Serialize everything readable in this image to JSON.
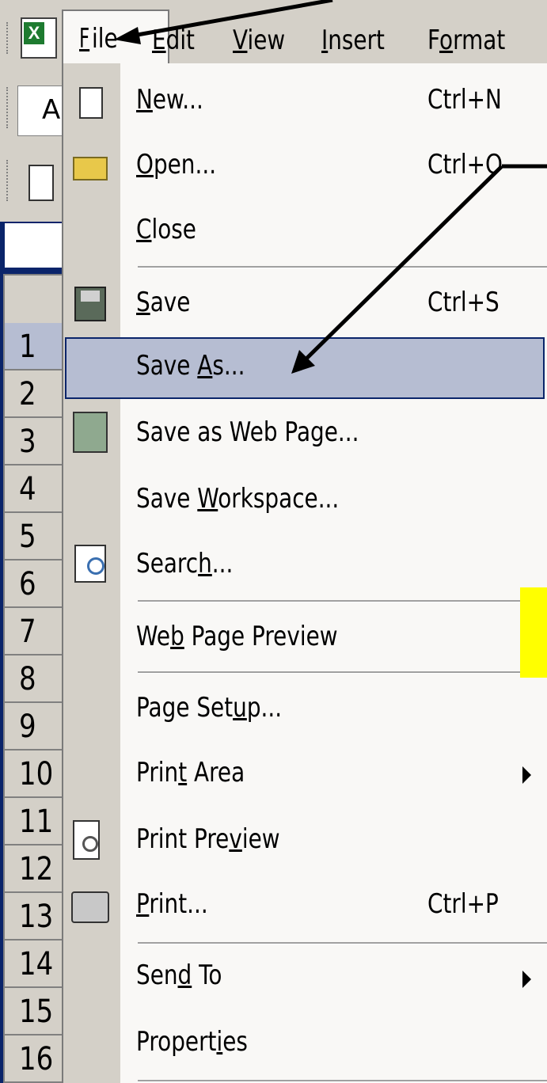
{
  "menubar": {
    "items": [
      {
        "label": "File",
        "mn": "F"
      },
      {
        "label": "Edit",
        "mn": "E"
      },
      {
        "label": "View",
        "mn": "V"
      },
      {
        "label": "Insert",
        "mn": "I"
      },
      {
        "label": "Format",
        "mn": "o"
      }
    ]
  },
  "namebox": {
    "value": "A"
  },
  "rows": [
    "1",
    "2",
    "3",
    "4",
    "5",
    "6",
    "7",
    "8",
    "9",
    "10",
    "11",
    "12",
    "13",
    "14",
    "15",
    "16"
  ],
  "file_menu": {
    "items": [
      {
        "label": "New...",
        "shortcut": "Ctrl+N",
        "icon": "new-document-icon"
      },
      {
        "label": "Open...",
        "shortcut": "Ctrl+O",
        "icon": "open-folder-icon"
      },
      {
        "label": "Close",
        "shortcut": ""
      },
      {
        "label": "Save",
        "shortcut": "Ctrl+S",
        "icon": "save-disk-icon"
      },
      {
        "label": "Save As...",
        "shortcut": "",
        "highlighted": true
      },
      {
        "label": "Save as Web Page...",
        "shortcut": "",
        "icon": "web-save-icon"
      },
      {
        "label": "Save Workspace...",
        "shortcut": ""
      },
      {
        "label": "Search...",
        "shortcut": "",
        "icon": "search-icon"
      },
      {
        "label": "Web Page Preview",
        "shortcut": ""
      },
      {
        "label": "Page Setup...",
        "shortcut": ""
      },
      {
        "label": "Print Area",
        "shortcut": "",
        "submenu": true
      },
      {
        "label": "Print Preview",
        "shortcut": "",
        "icon": "print-preview-icon"
      },
      {
        "label": "Print...",
        "shortcut": "Ctrl+P",
        "icon": "printer-icon"
      },
      {
        "label": "Send To",
        "shortcut": "",
        "submenu": true
      },
      {
        "label": "Properties",
        "shortcut": ""
      }
    ]
  },
  "colors": {
    "highlight": "#b6bdd2",
    "highlight_border": "#0a246a",
    "menu_bg": "#f9f8f6",
    "chrome": "#d4d0c8",
    "accent_yellow": "#ffff00"
  }
}
